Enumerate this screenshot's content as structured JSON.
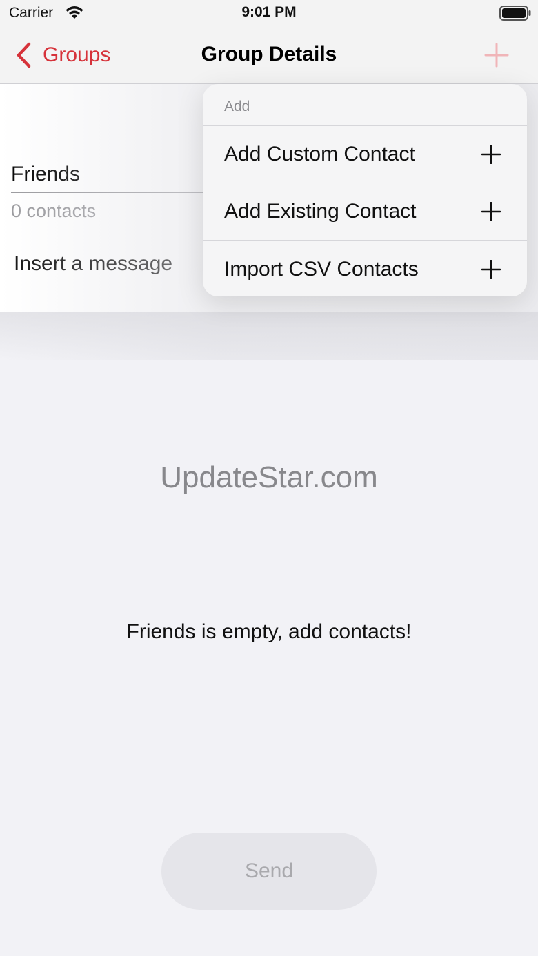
{
  "status_bar": {
    "carrier": "Carrier",
    "time": "9:01 PM"
  },
  "nav": {
    "back_label": "Groups",
    "title": "Group Details",
    "accent_color": "#d6323a",
    "add_icon": "plus-icon"
  },
  "group": {
    "name": "Friends",
    "contact_count": "0 contacts",
    "message_placeholder": "Insert a message"
  },
  "add_menu": {
    "header": "Add",
    "items": [
      {
        "label": "Add Custom Contact",
        "icon": "plus-icon"
      },
      {
        "label": "Add Existing Contact",
        "icon": "plus-icon"
      },
      {
        "label": "Import CSV Contacts",
        "icon": "plus-icon"
      }
    ]
  },
  "watermark": "UpdateStar.com",
  "empty_state": "Friends is empty, add contacts!",
  "send_label": "Send"
}
